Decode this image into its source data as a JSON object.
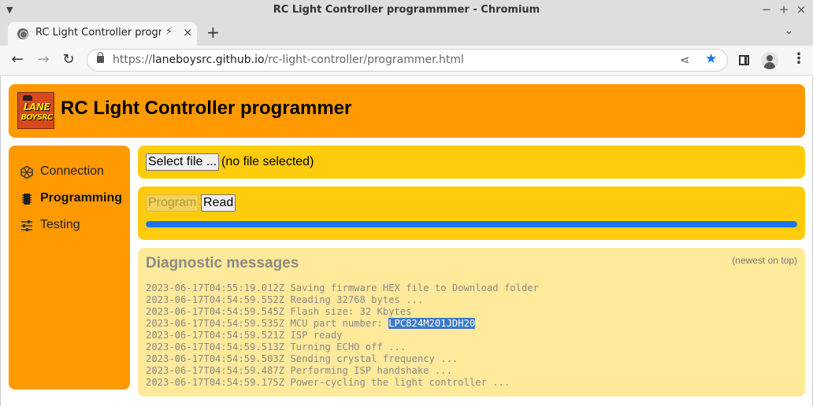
{
  "window": {
    "title": "RC Light Controller programmmer - Chromium"
  },
  "tab": {
    "title": "RC Light Controller program"
  },
  "address_bar": {
    "scheme": "https://",
    "host": "laneboysrc.github.io",
    "path": "/rc-light-controller/programmer.html"
  },
  "header": {
    "logo_line1": "LANE",
    "logo_line2": "BOYSRC",
    "title": "RC Light Controller programmer"
  },
  "sidebar": {
    "items": [
      {
        "label": "Connection",
        "icon": "hexagon-icon",
        "active": false
      },
      {
        "label": "Programming",
        "icon": "chip-icon",
        "active": true
      },
      {
        "label": "Testing",
        "icon": "sliders-icon",
        "active": false
      }
    ]
  },
  "file_panel": {
    "select_button": "Select file ...",
    "status": "(no file selected)"
  },
  "program_panel": {
    "program_button": "Program",
    "read_button": "Read",
    "progress_percent": 100
  },
  "diagnostics": {
    "title": "Diagnostic messages",
    "note": "(newest on top)",
    "messages": [
      {
        "time": "2023-06-17T04:55:19.012Z",
        "text": "Saving firmware HEX file to Download folder"
      },
      {
        "time": "2023-06-17T04:54:59.552Z",
        "text": "Reading 32768 bytes ..."
      },
      {
        "time": "2023-06-17T04:54:59.545Z",
        "text": "Flash size: 32 Kbytes"
      },
      {
        "time": "2023-06-17T04:54:59.535Z",
        "text": "MCU part number: ",
        "highlight": "LPC824M201JDH20"
      },
      {
        "time": "2023-06-17T04:54:59.521Z",
        "text": "ISP ready"
      },
      {
        "time": "2023-06-17T04:54:59.513Z",
        "text": "Turning ECHO off ..."
      },
      {
        "time": "2023-06-17T04:54:59.503Z",
        "text": "Sending crystal frequency ..."
      },
      {
        "time": "2023-06-17T04:54:59.487Z",
        "text": "Performing ISP handshake ..."
      },
      {
        "time": "2023-06-17T04:54:59.175Z",
        "text": "Power-cycling the light controller ..."
      }
    ]
  },
  "colors": {
    "header_bg": "#ff9900",
    "panel_bg": "#ffcc0d",
    "diag_bg": "#ffe99a",
    "progress": "#1a73e8",
    "highlight": "#3b78c9"
  }
}
